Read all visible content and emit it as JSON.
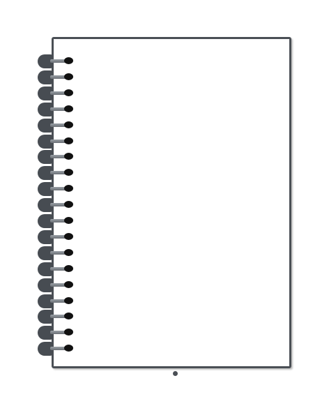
{
  "notebook": {
    "ring_count": 19,
    "colors": {
      "frame": "#4a4f55",
      "ring": "#474c52",
      "hole": "#111111",
      "page": "#ffffff"
    },
    "icons": {
      "binding": "spiral-binding-icon",
      "hole": "punch-hole-icon"
    }
  }
}
